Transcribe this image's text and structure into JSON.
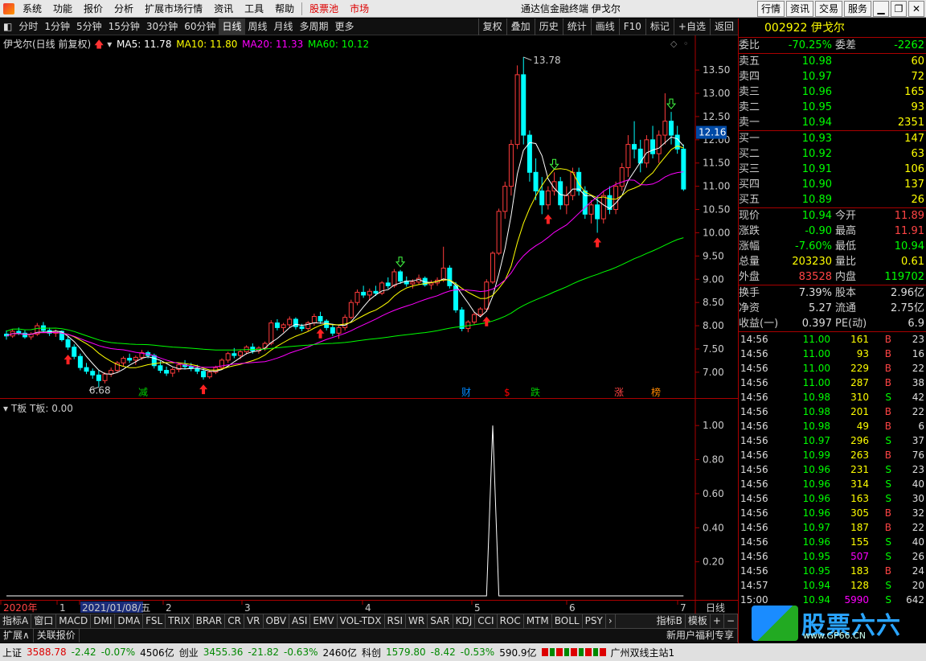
{
  "menu": {
    "items": [
      "系统",
      "功能",
      "报价",
      "分析",
      "扩展市场行情",
      "资讯",
      "工具",
      "帮助"
    ],
    "red_items": [
      "股票池",
      "市场"
    ],
    "title": "通达信金融终端 伊戈尔",
    "right_buttons": [
      "行情",
      "资讯",
      "交易",
      "服务"
    ]
  },
  "toolbar": {
    "periods": [
      "分时",
      "1分钟",
      "5分钟",
      "15分钟",
      "30分钟",
      "60分钟",
      "日线",
      "周线",
      "月线",
      "多周期",
      "更多"
    ],
    "active": "日线",
    "right": [
      "复权",
      "叠加",
      "历史",
      "统计",
      "画线",
      "F10",
      "标记",
      "+自选",
      "返回"
    ]
  },
  "chart_header": {
    "name": "伊戈尔(日线 前复权)",
    "ma5": "MA5: 11.78",
    "ma10": "MA10: 11.80",
    "ma20": "MA20: 11.33",
    "ma60": "MA60: 10.12"
  },
  "colors": {
    "up": "#ff3c3c",
    "down": "#00ffff",
    "ma5": "#ffffff",
    "ma10": "#ffff00",
    "ma20": "#ff00ff",
    "ma60": "#00ff00"
  },
  "chart_data": [
    {
      "type": "candlestick",
      "title": "伊戈尔(日线 前复权)",
      "x": "trading day index",
      "ylim": [
        6.6,
        13.9
      ],
      "yticks": [
        "13.50",
        "13.00",
        "12.50",
        "12.00",
        "11.50",
        "11.00",
        "10.50",
        "10.00",
        "9.50",
        "9.00",
        "8.50",
        "8.00",
        "7.50",
        "7.00"
      ],
      "current_price_label": "12.16",
      "annotations": {
        "high": "13.78",
        "low": "6.68"
      },
      "event_marks": [
        "减",
        "财",
        "$",
        "跌",
        "涨",
        "榜"
      ],
      "ohlc": [
        [
          7.82,
          7.9,
          7.7,
          7.78
        ],
        [
          7.78,
          7.92,
          7.74,
          7.88
        ],
        [
          7.88,
          7.96,
          7.8,
          7.84
        ],
        [
          7.84,
          7.9,
          7.72,
          7.76
        ],
        [
          7.76,
          7.86,
          7.7,
          7.82
        ],
        [
          7.82,
          8.06,
          7.78,
          8.0
        ],
        [
          8.0,
          8.08,
          7.86,
          7.9
        ],
        [
          7.9,
          7.96,
          7.78,
          7.84
        ],
        [
          7.84,
          7.92,
          7.76,
          7.88
        ],
        [
          7.88,
          7.9,
          7.66,
          7.7
        ],
        [
          7.7,
          7.78,
          7.48,
          7.54
        ],
        [
          7.54,
          7.6,
          7.28,
          7.34
        ],
        [
          7.34,
          7.4,
          7.04,
          7.1
        ],
        [
          7.1,
          7.2,
          6.96,
          7.02
        ],
        [
          7.02,
          7.08,
          6.86,
          6.94
        ],
        [
          6.94,
          7.04,
          6.68,
          6.82
        ],
        [
          6.82,
          7.0,
          6.76,
          6.96
        ],
        [
          6.96,
          7.1,
          6.9,
          7.04
        ],
        [
          7.04,
          7.24,
          7.0,
          7.2
        ],
        [
          7.2,
          7.34,
          7.12,
          7.3
        ],
        [
          7.3,
          7.4,
          7.2,
          7.26
        ],
        [
          7.26,
          7.36,
          7.16,
          7.32
        ],
        [
          7.32,
          7.48,
          7.26,
          7.42
        ],
        [
          7.42,
          7.46,
          7.3,
          7.36
        ],
        [
          7.36,
          7.4,
          7.08,
          7.14
        ],
        [
          7.14,
          7.24,
          6.98,
          7.04
        ],
        [
          7.04,
          7.12,
          6.92,
          6.98
        ],
        [
          6.98,
          7.1,
          6.9,
          7.06
        ],
        [
          7.06,
          7.2,
          7.0,
          7.16
        ],
        [
          7.16,
          7.26,
          7.06,
          7.12
        ],
        [
          7.12,
          7.2,
          7.02,
          7.08
        ],
        [
          7.08,
          7.16,
          6.96,
          7.02
        ],
        [
          7.02,
          7.1,
          6.84,
          6.9
        ],
        [
          6.9,
          7.04,
          6.86,
          7.0
        ],
        [
          7.0,
          7.14,
          6.96,
          7.1
        ],
        [
          7.1,
          7.3,
          7.06,
          7.26
        ],
        [
          7.26,
          7.44,
          7.2,
          7.4
        ],
        [
          7.4,
          7.52,
          7.3,
          7.36
        ],
        [
          7.36,
          7.48,
          7.28,
          7.44
        ],
        [
          7.44,
          7.58,
          7.38,
          7.54
        ],
        [
          7.54,
          7.62,
          7.4,
          7.46
        ],
        [
          7.46,
          7.56,
          7.4,
          7.52
        ],
        [
          7.52,
          7.66,
          7.46,
          7.62
        ],
        [
          7.62,
          8.12,
          7.58,
          8.06
        ],
        [
          8.06,
          8.14,
          7.9,
          7.96
        ],
        [
          7.96,
          8.06,
          7.86,
          8.02
        ],
        [
          8.02,
          8.2,
          7.96,
          8.14
        ],
        [
          8.14,
          8.18,
          7.92,
          7.98
        ],
        [
          7.98,
          8.04,
          7.88,
          7.94
        ],
        [
          7.94,
          8.1,
          7.88,
          8.06
        ],
        [
          8.06,
          8.26,
          8.0,
          8.2
        ],
        [
          8.2,
          8.3,
          8.04,
          8.1
        ],
        [
          8.1,
          8.14,
          7.9,
          7.96
        ],
        [
          7.96,
          8.04,
          7.78,
          7.84
        ],
        [
          7.84,
          8.0,
          7.72,
          7.96
        ],
        [
          7.96,
          8.24,
          7.9,
          8.18
        ],
        [
          8.18,
          8.56,
          8.14,
          8.5
        ],
        [
          8.5,
          8.78,
          8.44,
          8.72
        ],
        [
          8.72,
          8.86,
          8.6,
          8.66
        ],
        [
          8.66,
          8.8,
          8.54,
          8.74
        ],
        [
          8.74,
          8.86,
          8.64,
          8.7
        ],
        [
          8.7,
          8.96,
          8.66,
          8.92
        ],
        [
          8.92,
          9.04,
          8.8,
          8.86
        ],
        [
          8.86,
          9.22,
          8.82,
          9.16
        ],
        [
          9.16,
          9.2,
          8.9,
          8.96
        ],
        [
          8.96,
          9.06,
          8.84,
          8.9
        ],
        [
          8.9,
          9.0,
          8.8,
          8.94
        ],
        [
          8.94,
          9.1,
          8.88,
          9.02
        ],
        [
          9.02,
          9.06,
          8.84,
          8.88
        ],
        [
          8.88,
          8.98,
          8.78,
          8.92
        ],
        [
          8.92,
          9.04,
          8.86,
          8.98
        ],
        [
          8.98,
          9.7,
          8.94,
          9.24
        ],
        [
          9.24,
          9.3,
          8.8,
          8.86
        ],
        [
          8.86,
          8.94,
          8.28,
          8.34
        ],
        [
          8.34,
          8.4,
          7.88,
          7.94
        ],
        [
          7.94,
          8.12,
          7.86,
          8.08
        ],
        [
          8.08,
          8.3,
          8.02,
          8.24
        ],
        [
          8.24,
          8.4,
          8.18,
          8.36
        ],
        [
          8.36,
          9.0,
          8.3,
          8.94
        ],
        [
          8.94,
          9.6,
          8.9,
          9.56
        ],
        [
          9.56,
          10.52,
          9.52,
          10.46
        ],
        [
          10.46,
          11.1,
          10.3,
          11.0
        ],
        [
          11.0,
          12.0,
          10.8,
          11.9
        ],
        [
          11.9,
          13.6,
          11.8,
          13.4
        ],
        [
          13.4,
          13.78,
          11.9,
          12.1
        ],
        [
          12.1,
          12.2,
          11.1,
          11.3
        ],
        [
          11.3,
          11.6,
          10.7,
          10.9
        ],
        [
          10.9,
          11.2,
          10.4,
          10.6
        ],
        [
          10.6,
          11.0,
          10.5,
          10.9
        ],
        [
          10.9,
          11.3,
          10.8,
          11.1
        ],
        [
          11.1,
          11.2,
          10.5,
          10.6
        ],
        [
          10.6,
          11.0,
          10.4,
          10.8
        ],
        [
          10.8,
          11.4,
          10.7,
          11.3
        ],
        [
          11.3,
          11.4,
          10.8,
          10.9
        ],
        [
          10.9,
          11.0,
          10.3,
          10.4
        ],
        [
          10.4,
          10.7,
          10.2,
          10.6
        ],
        [
          10.6,
          10.8,
          10.0,
          10.3
        ],
        [
          10.3,
          10.9,
          10.2,
          10.8
        ],
        [
          10.8,
          11.0,
          10.4,
          10.5
        ],
        [
          10.5,
          11.1,
          10.4,
          11.0
        ],
        [
          11.0,
          11.5,
          10.9,
          11.4
        ],
        [
          11.4,
          12.1,
          11.2,
          11.9
        ],
        [
          11.9,
          12.4,
          11.6,
          11.8
        ],
        [
          11.8,
          12.0,
          11.3,
          11.5
        ],
        [
          11.5,
          12.1,
          11.4,
          12.0
        ],
        [
          12.0,
          12.3,
          11.6,
          11.7
        ],
        [
          11.7,
          12.2,
          11.5,
          12.1
        ],
        [
          12.1,
          13.0,
          11.9,
          12.4
        ],
        [
          12.4,
          12.6,
          11.9,
          12.1
        ],
        [
          12.1,
          12.3,
          11.7,
          11.8
        ],
        [
          11.8,
          11.9,
          10.9,
          10.94
        ]
      ]
    },
    {
      "type": "line",
      "title": "T板",
      "series": [
        {
          "name": "T板: 0.00",
          "values_sparse": {
            "79": 1.0
          }
        }
      ],
      "ylim": [
        0,
        1.1
      ],
      "yticks": [
        "1.00",
        "0.80",
        "0.60",
        "0.40",
        "0.20"
      ]
    }
  ],
  "xaxis": {
    "labels": [
      "2020年",
      "1",
      "2021/01/08/五",
      "2",
      "3",
      "4",
      "5",
      "6",
      "7"
    ],
    "period": "日线"
  },
  "indicator_tabs": [
    "指标A",
    "窗口",
    "MACD",
    "DMI",
    "DMA",
    "FSL",
    "TRIX",
    "BRAR",
    "CR",
    "VR",
    "OBV",
    "ASI",
    "EMV",
    "VOL-TDX",
    "RSI",
    "WR",
    "SAR",
    "KDJ",
    "CCI",
    "ROC",
    "MTM",
    "BOLL",
    "PSY"
  ],
  "indicator_tabs_right": [
    "指标B",
    "模板",
    "+",
    "−"
  ],
  "subbar": [
    "扩展∧",
    "关联报价"
  ],
  "subbar_right": "新用户福利专享",
  "quote": {
    "code": "002922",
    "name": "伊戈尔",
    "weibi_label": "委比",
    "weibi": "-70.25%",
    "weicha_label": "委差",
    "weicha": "-2262",
    "asks": [
      {
        "label": "卖五",
        "price": "10.98",
        "vol": "60"
      },
      {
        "label": "卖四",
        "price": "10.97",
        "vol": "72"
      },
      {
        "label": "卖三",
        "price": "10.96",
        "vol": "165"
      },
      {
        "label": "卖二",
        "price": "10.95",
        "vol": "93"
      },
      {
        "label": "卖一",
        "price": "10.94",
        "vol": "2351"
      }
    ],
    "bids": [
      {
        "label": "买一",
        "price": "10.93",
        "vol": "147"
      },
      {
        "label": "买二",
        "price": "10.92",
        "vol": "63"
      },
      {
        "label": "买三",
        "price": "10.91",
        "vol": "106"
      },
      {
        "label": "买四",
        "price": "10.90",
        "vol": "137"
      },
      {
        "label": "买五",
        "price": "10.89",
        "vol": "26"
      }
    ],
    "stats": [
      {
        "l": "现价",
        "v": "10.94",
        "l2": "今开",
        "v2": "11.89",
        "c": "c-g",
        "c2": "c-r"
      },
      {
        "l": "涨跌",
        "v": "-0.90",
        "l2": "最高",
        "v2": "11.91",
        "c": "c-g",
        "c2": "c-r"
      },
      {
        "l": "涨幅",
        "v": "-7.60%",
        "l2": "最低",
        "v2": "10.94",
        "c": "c-g",
        "c2": "c-g"
      },
      {
        "l": "总量",
        "v": "203230",
        "l2": "量比",
        "v2": "0.61",
        "c": "c-y",
        "c2": "c-y"
      },
      {
        "l": "外盘",
        "v": "83528",
        "l2": "内盘",
        "v2": "119702",
        "c": "c-r",
        "c2": "c-g"
      }
    ],
    "stats2": [
      {
        "l": "换手",
        "v": "7.39%",
        "l2": "股本",
        "v2": "2.96亿"
      },
      {
        "l": "净资",
        "v": "5.27",
        "l2": "流通",
        "v2": "2.75亿"
      },
      {
        "l": "收益(一)",
        "v": "0.397",
        "l2": "PE(动)",
        "v2": "6.9"
      }
    ],
    "ticks": [
      [
        "14:56",
        "11.00",
        "161",
        "B",
        "23"
      ],
      [
        "14:56",
        "11.00",
        "93",
        "B",
        "16"
      ],
      [
        "14:56",
        "11.00",
        "229",
        "B",
        "22"
      ],
      [
        "14:56",
        "11.00",
        "287",
        "B",
        "38"
      ],
      [
        "14:56",
        "10.98",
        "310",
        "S",
        "42"
      ],
      [
        "14:56",
        "10.98",
        "201",
        "B",
        "22"
      ],
      [
        "14:56",
        "10.98",
        "49",
        "B",
        "6"
      ],
      [
        "14:56",
        "10.97",
        "296",
        "S",
        "37"
      ],
      [
        "14:56",
        "10.99",
        "263",
        "B",
        "76"
      ],
      [
        "14:56",
        "10.96",
        "231",
        "S",
        "23"
      ],
      [
        "14:56",
        "10.96",
        "314",
        "S",
        "40"
      ],
      [
        "14:56",
        "10.96",
        "163",
        "S",
        "30"
      ],
      [
        "14:56",
        "10.96",
        "305",
        "B",
        "32"
      ],
      [
        "14:56",
        "10.97",
        "187",
        "B",
        "22"
      ],
      [
        "14:56",
        "10.96",
        "155",
        "S",
        "40"
      ],
      [
        "14:56",
        "10.95",
        "507",
        "S",
        "26"
      ],
      [
        "14:56",
        "10.95",
        "183",
        "B",
        "24"
      ],
      [
        "14:57",
        "10.94",
        "128",
        "S",
        "20"
      ],
      [
        "15:00",
        "10.94",
        "5990",
        "S",
        "642"
      ]
    ]
  },
  "statusbar": {
    "sh_label": "上证",
    "sh": "3588.78",
    "sh_chg": "-2.42",
    "sh_pct": "-0.07%",
    "sh_amt": "4506亿",
    "cy_label": "创业",
    "cy": "3455.36",
    "cy_chg": "-21.82",
    "cy_pct": "-0.63%",
    "cy_amt": "2460亿",
    "kc_label": "科创",
    "kc": "1579.80",
    "kc_chg": "-8.42",
    "kc_pct": "-0.53%",
    "kc_amt": "590.9亿",
    "server": "广州双线主站1"
  },
  "watermark": {
    "text": "股票六六",
    "url": "www.GP66.CN"
  }
}
